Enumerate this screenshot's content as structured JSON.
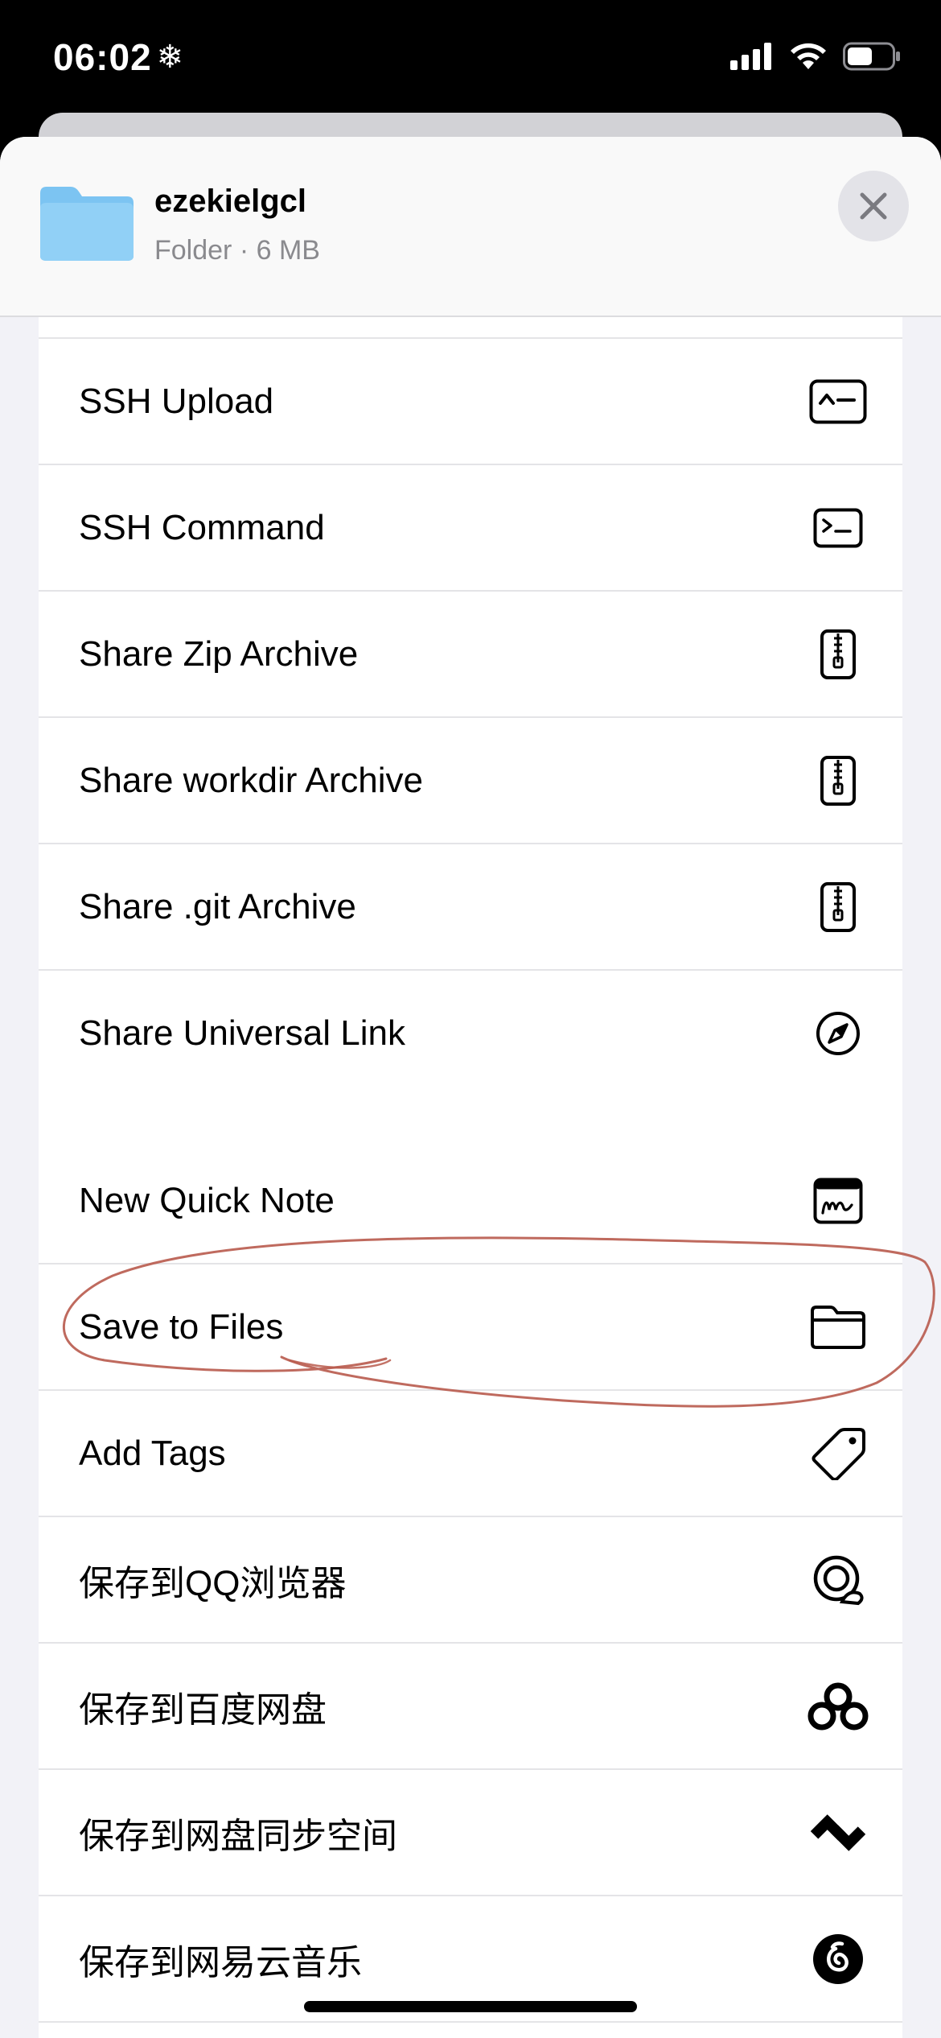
{
  "status": {
    "time": "06:02",
    "snow_glyph": "❄"
  },
  "header": {
    "title": "ezekielgcl",
    "subtitle": "Folder · 6 MB"
  },
  "group1": {
    "items": [
      {
        "label": "SSH Upload",
        "icon": "terminal-caret-icon"
      },
      {
        "label": "SSH Command",
        "icon": "terminal-prompt-icon"
      },
      {
        "label": "Share Zip Archive",
        "icon": "zip-archive-icon"
      },
      {
        "label": "Share workdir Archive",
        "icon": "zip-archive-icon"
      },
      {
        "label": "Share .git Archive",
        "icon": "zip-archive-icon"
      },
      {
        "label": "Share Universal Link",
        "icon": "compass-icon"
      }
    ]
  },
  "group2": {
    "items": [
      {
        "label": "New Quick Note",
        "icon": "quick-note-icon"
      },
      {
        "label": "Save to Files",
        "icon": "folder-outline-icon"
      },
      {
        "label": "Add Tags",
        "icon": "tag-icon"
      },
      {
        "label": "保存到QQ浏览器",
        "icon": "qq-browser-icon"
      },
      {
        "label": "保存到百度网盘",
        "icon": "baidu-netdisk-icon"
      },
      {
        "label": "保存到网盘同步空间",
        "icon": "sync-space-icon"
      },
      {
        "label": "保存到网易云音乐",
        "icon": "netease-music-icon"
      }
    ]
  },
  "colors": {
    "folder_blue": "#7cc4f2",
    "annotation_red": "#b85a4c",
    "sheet_bg": "#f2f2f7"
  }
}
